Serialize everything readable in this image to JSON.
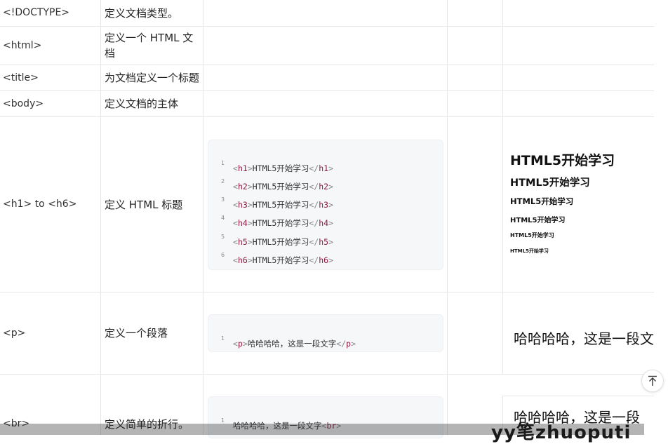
{
  "rows": [
    {
      "tag": "<!DOCTYPE>",
      "desc": "定义文档类型。"
    },
    {
      "tag": "<html>",
      "desc": "定义一个 HTML 文档"
    },
    {
      "tag": "<title>",
      "desc": "为文档定义一个标题"
    },
    {
      "tag": "<body>",
      "desc": "定义文档的主体"
    },
    {
      "tag": "<h1> to <h6>",
      "desc": "定义 HTML 标题"
    },
    {
      "tag": "<p>",
      "desc": "定义一个段落"
    },
    {
      "tag": "<br>",
      "desc": "定义简单的折行。"
    }
  ],
  "heading_code": [
    {
      "num": "1",
      "open": "h1",
      "text": "HTML5开始学习",
      "close": "h1"
    },
    {
      "num": "2",
      "open": "h2",
      "text": "HTML5开始学习",
      "close": "h2"
    },
    {
      "num": "3",
      "open": "h3",
      "text": "HTML5开始学习",
      "close": "h3"
    },
    {
      "num": "4",
      "open": "h4",
      "text": "HTML5开始学习",
      "close": "h4"
    },
    {
      "num": "5",
      "open": "h5",
      "text": "HTML5开始学习",
      "close": "h5"
    },
    {
      "num": "6",
      "open": "h6",
      "text": "HTML5开始学习",
      "close": "h6"
    }
  ],
  "heading_preview": [
    "HTML5开始学习",
    "HTML5开始学习",
    "HTML5开始学习",
    "HTML5开始学习",
    "HTML5开始学习",
    "HTML5开始学习"
  ],
  "p_code": {
    "num": "1",
    "open": "p",
    "text": "哈哈哈哈，这是一段文字",
    "close": "p"
  },
  "p_preview": "哈哈哈哈，这是一段文",
  "br_code": {
    "num": "1",
    "text": "哈哈哈哈，这是一段文字",
    "tag": "br"
  },
  "br_preview": "哈哈哈哈，这是一段",
  "watermark": "yy笔zhuoputi",
  "back_to_top_icon": "arrow-up-to-line-icon"
}
